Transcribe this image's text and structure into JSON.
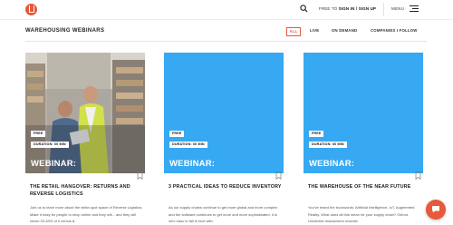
{
  "header": {
    "logo_icon": "brand-logo-icon",
    "search_icon": "search-icon",
    "signin_prefix": "FREE TO",
    "signin_link": "SIGN IN / SIGN UP",
    "menu_label": "MENU",
    "menu_icon": "hamburger-menu-icon"
  },
  "section": {
    "title": "WAREHOUSING WEBINARS",
    "filters": [
      "ALL",
      "LIVE",
      "ON DEMAND",
      "COMPANIES I FOLLOW"
    ],
    "active_filter": "ALL"
  },
  "cards": [
    {
      "image": "photo-warehouse-workers",
      "badge_free": "FREE",
      "badge_duration": "DURATION: 60 MIN",
      "label": "WEBINAR:",
      "title": "THE RETAIL HANGOVER: RETURNS AND REVERSE LOGISTICS",
      "description": "Join us to learn more about the white-spot space of Reverse Logistics. Make it easy for people to shop online and they will... and they will return 20-40% of it versus 8-"
    },
    {
      "image": "blue-placeholder",
      "badge_free": "FREE",
      "badge_duration": "DURATION: 60 MIN",
      "label": "WEBINAR:",
      "title": "3 PRACTICAL IDEAS TO REDUCE INVENTORY",
      "description": "As our supply chains continue to get more global and more complex and the software continues to get more and more sophisticated, it is very easy to fall in love with"
    },
    {
      "image": "blue-placeholder",
      "badge_free": "FREE",
      "badge_duration": "DURATION: 60 MIN",
      "label": "WEBINAR:",
      "title": "THE WAREHOUSE OF THE NEAR FUTURE",
      "description": "You've heard the buzzwords: Artificial Intelligence, IoT, Augmented Reality. What does all this mean for your supply chain? Oxford University researchers recently"
    }
  ],
  "chat": {
    "icon": "chat-bubble-icon"
  },
  "colors": {
    "accent": "#e8583a",
    "card_blue": "#36a9f2",
    "text_dark": "#222222",
    "divider": "#e6e6e6"
  }
}
